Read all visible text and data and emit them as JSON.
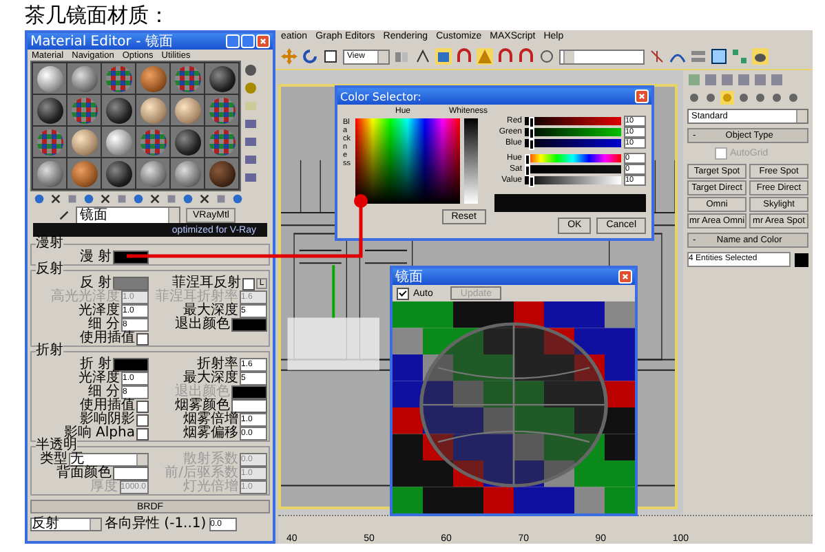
{
  "heading": "茶几镜面材质：",
  "max": {
    "menu": [
      "eation",
      "Graph Editors",
      "Rendering",
      "Customize",
      "MAXScript",
      "Help"
    ],
    "view_dropdown": "View",
    "command_panel": {
      "dropdown": "Standard",
      "object_type": {
        "toggle": "-",
        "title": "Object Type",
        "autogrid": {
          "label": "AutoGrid",
          "checked": false,
          "disabled": true
        },
        "buttons": [
          "Target Spot",
          "Free Spot",
          "Target Direct",
          "Free Direct",
          "Omni",
          "Skylight",
          "mr Area Omni",
          "mr Area Spot"
        ]
      },
      "name_and_color": {
        "toggle": "-",
        "title": "Name and Color",
        "value": "4 Entities Selected",
        "color": "#000000"
      }
    },
    "timeline": [
      "40",
      "50",
      "60",
      "70",
      "90",
      "100"
    ]
  },
  "material_editor": {
    "title": "Material Editor - 镜面",
    "menu": [
      "Material",
      "Navigation",
      "Options",
      "Utilities"
    ],
    "material_name": "镜面",
    "type_button": "VRayMtl",
    "banner": "optimized for V-Ray",
    "groups": [
      {
        "title": "漫射",
        "left": [
          {
            "kind": "swatch",
            "label": "漫 射",
            "color": "#000000",
            "disabled": false
          }
        ]
      },
      {
        "title": "反射",
        "left": [
          {
            "kind": "swatch",
            "label": "反 射",
            "color": "#7a7a7a",
            "disabled": false
          },
          {
            "kind": "spinner",
            "label": "高光光泽度",
            "value": "1.0",
            "disabled": true
          },
          {
            "kind": "spinner",
            "label": "光泽度",
            "value": "1.0",
            "disabled": false
          },
          {
            "kind": "spinner",
            "label": "细 分",
            "value": "8",
            "disabled": false
          },
          {
            "kind": "checkbox",
            "label": "使用插值",
            "checked": false,
            "disabled": false
          }
        ],
        "right": [
          {
            "kind": "checkbox",
            "label": "菲涅耳反射",
            "checked": false,
            "disabled": false,
            "button": "L"
          },
          {
            "kind": "spinner",
            "label": "菲涅耳折射率",
            "value": "1.6",
            "disabled": true
          },
          {
            "kind": "spinner",
            "label": "最大深度",
            "value": "5",
            "disabled": false
          },
          {
            "kind": "swatch",
            "label": "退出颜色",
            "color": "#000000",
            "disabled": false
          }
        ]
      },
      {
        "title": "折射",
        "left": [
          {
            "kind": "swatch",
            "label": "折 射",
            "color": "#000000",
            "disabled": false
          },
          {
            "kind": "spinner",
            "label": "光泽度",
            "value": "1.0",
            "disabled": false
          },
          {
            "kind": "spinner",
            "label": "细 分",
            "value": "8",
            "disabled": false
          },
          {
            "kind": "checkbox",
            "label": "使用插值",
            "checked": false,
            "disabled": false
          },
          {
            "kind": "checkbox",
            "label": "影响阴影",
            "checked": false,
            "disabled": false
          },
          {
            "kind": "checkbox",
            "label": "影响 Alpha",
            "checked": false,
            "disabled": false
          }
        ],
        "right": [
          {
            "kind": "spinner",
            "label": "折射率",
            "value": "1.6",
            "disabled": false
          },
          {
            "kind": "spinner",
            "label": "最大深度",
            "value": "5",
            "disabled": false
          },
          {
            "kind": "swatch",
            "label": "退出颜色",
            "color": "#000000",
            "disabled": true
          },
          {
            "kind": "swatch",
            "label": "烟雾颜色",
            "color": "#ffffff",
            "disabled": false
          },
          {
            "kind": "spinner",
            "label": "烟雾倍增",
            "value": "1.0",
            "disabled": false
          },
          {
            "kind": "spinner",
            "label": "烟雾偏移",
            "value": "0.0",
            "disabled": false
          }
        ]
      },
      {
        "title": "半透明",
        "left": [
          {
            "kind": "dropdown",
            "label": "类型",
            "value": "无",
            "disabled": false
          },
          {
            "kind": "swatch",
            "label": "背面颜色",
            "color": "#ffffff",
            "disabled": false
          },
          {
            "kind": "spinner",
            "label": "厚度",
            "value": "1000.0",
            "disabled": true
          }
        ],
        "right": [
          {
            "kind": "spinner",
            "label": "散射系数",
            "value": "0.0",
            "disabled": true
          },
          {
            "kind": "spinner",
            "label": "前/后驱系数",
            "value": "1.0",
            "disabled": true
          },
          {
            "kind": "spinner",
            "label": "灯光倍增",
            "value": "1.0",
            "disabled": true
          }
        ]
      }
    ],
    "brdf": {
      "title": "BRDF",
      "dropdown": "反射",
      "label": "各向异性 (-1..1)",
      "value": "0.0"
    }
  },
  "color_selector": {
    "title": "Color Selector:",
    "hue_label": "Hue",
    "whiteness_label": "Whiteness",
    "blackness_label": "Blackness",
    "channels": [
      {
        "label": "Red",
        "value": "10",
        "level": 0.04
      },
      {
        "label": "Green",
        "value": "10",
        "level": 0.04
      },
      {
        "label": "Blue",
        "value": "10",
        "level": 0.04
      },
      {
        "label": "Hue",
        "value": "0",
        "level": 0
      },
      {
        "label": "Sat",
        "value": "0",
        "level": 0
      },
      {
        "label": "Value",
        "value": "10",
        "level": 0.04
      }
    ],
    "buttons": {
      "reset": "Reset",
      "ok": "OK",
      "cancel": "Cancel"
    }
  },
  "preview": {
    "title": "镜面",
    "auto": {
      "label": "Auto",
      "checked": true
    },
    "update": {
      "label": "Update",
      "disabled": true
    }
  }
}
